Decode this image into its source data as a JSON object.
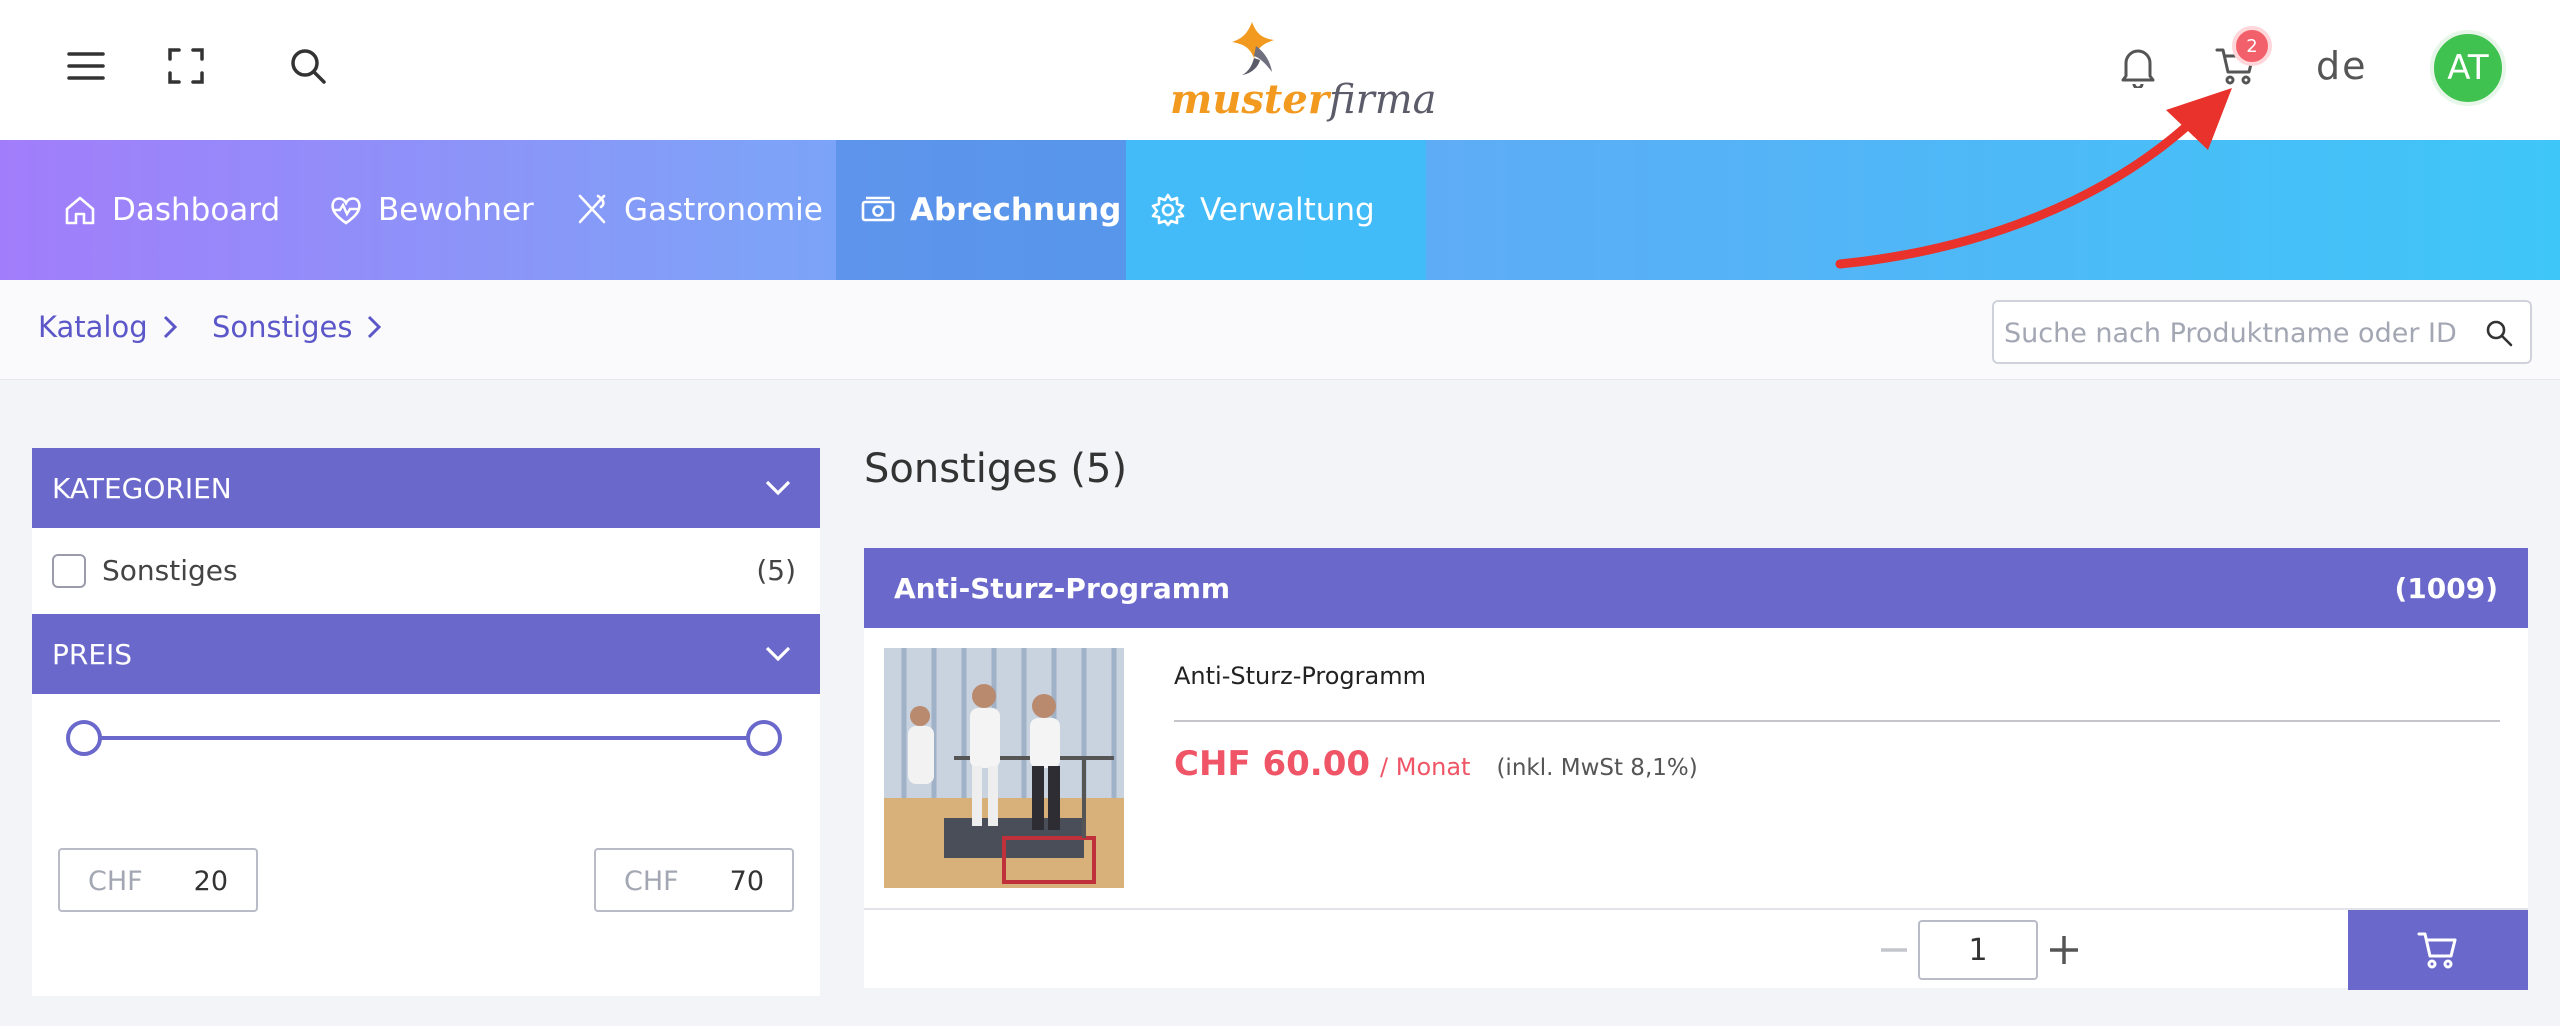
{
  "header": {
    "logo": {
      "part1": "muster",
      "part2": "firma"
    },
    "cart_badge": "2",
    "language": "de",
    "avatar_initials": "AT"
  },
  "nav": {
    "items": [
      {
        "label": "Dashboard",
        "icon": "home-icon"
      },
      {
        "label": "Bewohner",
        "icon": "heart-pulse-icon"
      },
      {
        "label": "Gastronomie",
        "icon": "utensils-icon"
      },
      {
        "label": "Abrechnung",
        "icon": "money-icon",
        "active": true
      },
      {
        "label": "Verwaltung",
        "icon": "gear-icon"
      }
    ]
  },
  "breadcrumb": [
    "Katalog",
    "Sonstiges"
  ],
  "search": {
    "placeholder": "Suche nach Produktname oder ID",
    "value": ""
  },
  "sidebar": {
    "categories_title": "KATEGORIEN",
    "category": {
      "label": "Sonstiges",
      "count": "(5)",
      "checked": false
    },
    "price_title": "PREIS",
    "price_min": {
      "currency": "CHF",
      "value": "20"
    },
    "price_max": {
      "currency": "CHF",
      "value": "70"
    }
  },
  "main": {
    "title": "Sonstiges (5)",
    "product": {
      "header_name": "Anti-Sturz-Programm",
      "header_id": "(1009)",
      "name": "Anti-Sturz-Programm",
      "price": "CHF 60.00",
      "per": "/ Monat",
      "vat": "(inkl. MwSt 8,1%)",
      "quantity": "1"
    }
  },
  "colors": {
    "accent": "#6b68cb",
    "price": "#ef5566",
    "badge": "#f2616b",
    "avatar": "#3fc24f",
    "arrow": "#e8322b"
  }
}
